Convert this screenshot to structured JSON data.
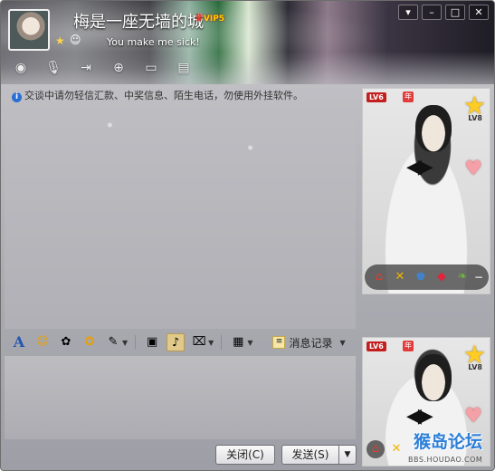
{
  "header": {
    "nickname": "梅是一座无墙的城",
    "vip_label": "VIP5",
    "signature": "You make me sick!",
    "title_buttons": [
      "▣",
      "—",
      "□",
      "✕"
    ],
    "tools": [
      "camera-icon",
      "microphone-icon",
      "file-transfer-icon",
      "add-friend-icon",
      "screen-share-icon",
      "more-icon"
    ]
  },
  "notice": {
    "text": "交谈中请勿轻信汇款、中奖信息、陌生电话，勿使用外挂软件。"
  },
  "chat_toolbar": {
    "history_label": "消息记录"
  },
  "buttons": {
    "close": "关闭(C)",
    "send": "发送(S)"
  },
  "profile_top": {
    "level": "LV6",
    "year_badge": "年",
    "star_level": "LV8"
  },
  "profile_bottom": {
    "level": "LV6",
    "year_badge": "年",
    "star_level": "LV8",
    "forum_name": "猴岛论坛",
    "forum_url": "BBS.HOUDAO.COM"
  }
}
